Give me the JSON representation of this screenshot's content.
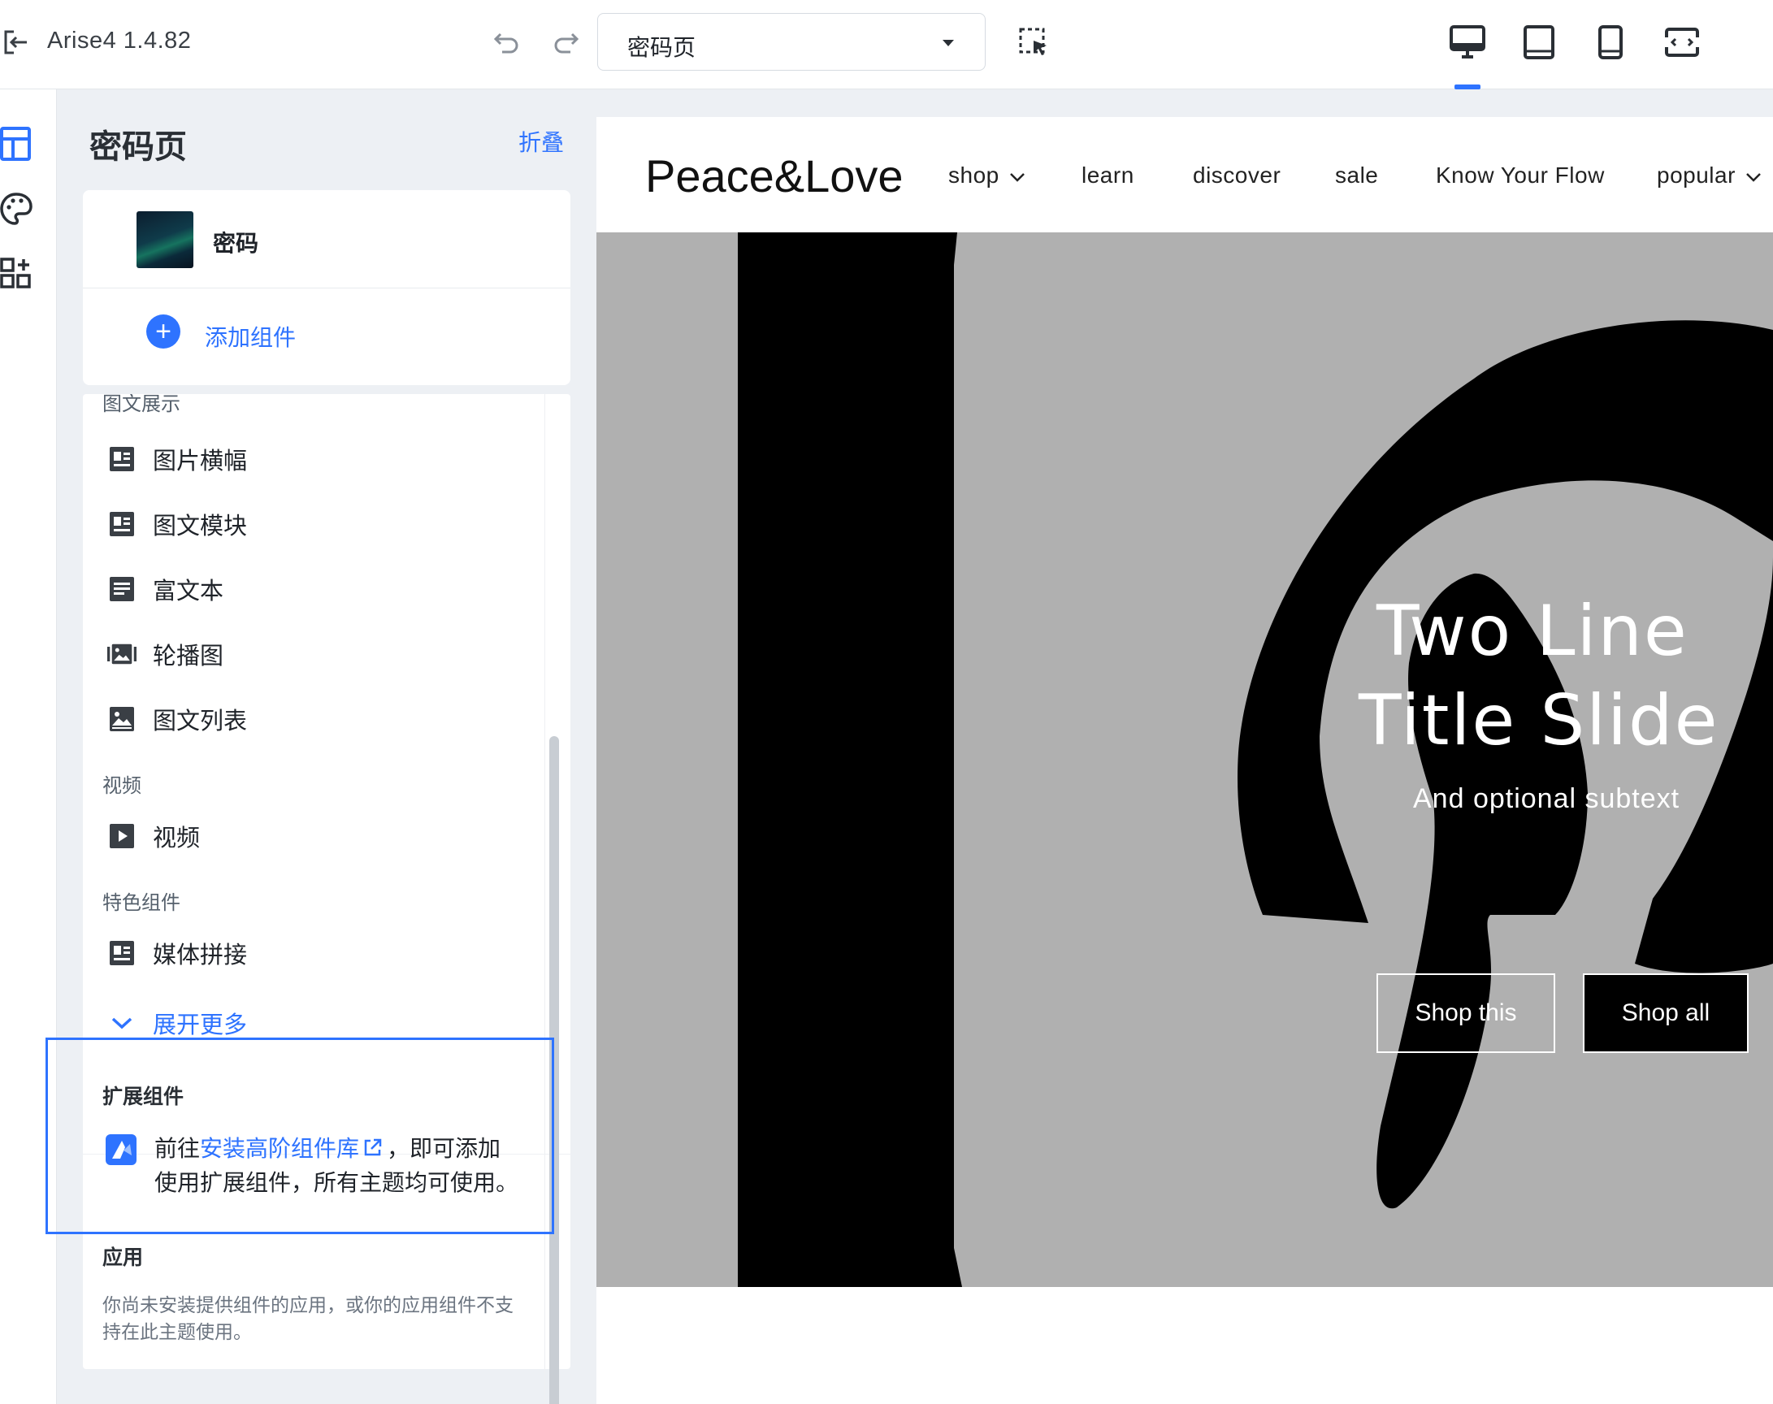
{
  "app": {
    "title": "Arise4 1.4.82"
  },
  "toolbar": {
    "page_select_value": "密码页"
  },
  "panel": {
    "title": "密码页",
    "collapse_label": "折叠",
    "section_name": "密码",
    "add_component_label": "添加组件",
    "categories": {
      "image_text": "图文展示",
      "video": "视频",
      "featured": "特色组件"
    },
    "items": {
      "image_banner": "图片横幅",
      "image_text_block": "图文模块",
      "rich_text": "富文本",
      "carousel": "轮播图",
      "image_text_list": "图文列表",
      "video": "视频",
      "media_collage": "媒体拼接"
    },
    "expand_more_label": "展开更多",
    "extension": {
      "title": "扩展组件",
      "text_before": "前往",
      "link_text": "安装高阶组件库",
      "text_after": "，即可添加使用扩展组件，所有主题均可使用。"
    },
    "apps": {
      "title": "应用",
      "desc": "你尚未安装提供组件的应用，或你的应用组件不支持在此主题使用。"
    }
  },
  "preview": {
    "brand": "Peace&Love",
    "nav": [
      "shop",
      "learn",
      "discover",
      "sale",
      "Know Your Flow",
      "popular"
    ],
    "hero": {
      "title_line1": "Two Line",
      "title_line2": "Title Slide",
      "subtext": "And optional subtext",
      "button1": "Shop this",
      "button2": "Shop all"
    }
  },
  "colors": {
    "accent": "#2e73ff",
    "hero_bg": "#b0b0b0"
  }
}
